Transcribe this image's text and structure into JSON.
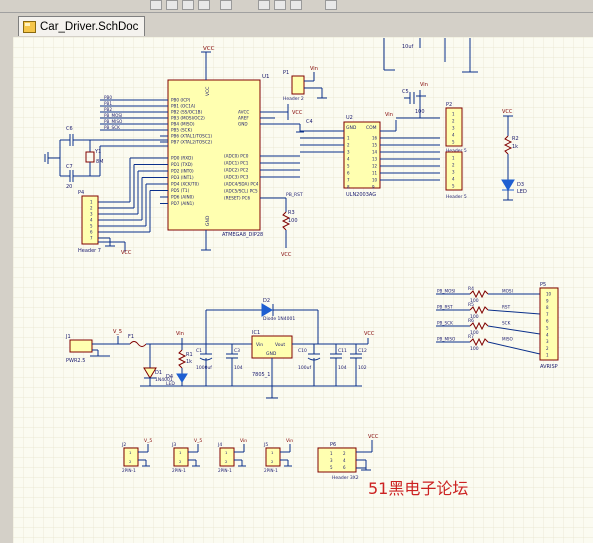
{
  "app": {
    "tab_label": "Car_Driver.SchDoc"
  },
  "toolbar": {
    "icons": [
      "new-icon",
      "open-icon",
      "save-icon",
      "print-icon",
      "zoom-icon",
      "cut-icon",
      "copy-icon",
      "paste-icon",
      "delete-icon"
    ]
  },
  "schematic": {
    "power": {
      "vcc": "VCC",
      "vin": "Vin",
      "v5": "V_5"
    },
    "u1": {
      "ref": "U1",
      "name": "ATMEGA8_DIP28",
      "pb_pins": [
        "PB0 (ICP)",
        "PB1 (OC1A)",
        "PB2 (SS/OC1B)",
        "PB3 (MOSI/OC2)",
        "PB4 (MISO)",
        "PB5 (SCK)",
        "PB6 (XTAL1/TOSC1)",
        "PB7 (XTAL2/TOSC2)"
      ],
      "pd_pins": [
        "PD0 (RXD)",
        "PD1 (TXD)",
        "PD2 (INT0)",
        "PD3 (INT1)",
        "PD4 (XCK/T0)",
        "PD5 (T1)",
        "PD6 (AIN0)",
        "PD7 (AIN1)"
      ],
      "right_top": [
        "AVCC",
        "AREF",
        "GND"
      ],
      "pc_pins": [
        "(ADC0) PC0",
        "(ADC1) PC1",
        "(ADC2) PC2",
        "(ADC3) PC3",
        "(ADC4/SDA) PC4",
        "(ADC5/SCL) PC5",
        "(RESET) PC6"
      ],
      "vcc_label": "VCC",
      "gnd_label": "GND",
      "pb_nets": [
        "PB0",
        "PB1",
        "PB2",
        "PB_MOSI",
        "PB_MISO",
        "PB_SCK"
      ],
      "pd_nets": [
        "PD0",
        "PD1",
        "PD2",
        "PD3"
      ],
      "rst_net": "PB_RST"
    },
    "u2": {
      "ref": "U2",
      "name": "ULN2003AG",
      "left_top": "GND",
      "right_top": "COM"
    },
    "crystal": {
      "ref": "Y1",
      "value": "8M",
      "c6": "C6",
      "c7": "C7",
      "cval": "20"
    },
    "p1": {
      "ref": "P1",
      "name": "Header 2"
    },
    "p2": {
      "ref": "P2",
      "name": "Header 5"
    },
    "p3": {
      "ref": "P3",
      "name": "Header 5"
    },
    "p4": {
      "ref": "P4",
      "name": "Header 7"
    },
    "p5": {
      "ref": "P5",
      "name": "AVRISP"
    },
    "p6": {
      "ref": "P6",
      "name": "Header 3X2"
    },
    "r2": {
      "ref": "R2",
      "value": "1k"
    },
    "r3": {
      "ref": "R3",
      "value": "100"
    },
    "d3": {
      "ref": "D3",
      "name": "LED"
    },
    "c4": {
      "ref": "C4",
      "value": "10uf"
    },
    "c5": {
      "ref": "C5",
      "value": "100"
    },
    "isp": {
      "nets": [
        "PB_MOSI",
        "PB_RST",
        "PB_SCK",
        "PB_MISO"
      ],
      "resistors": [
        "R4",
        "R5",
        "R6",
        "R7"
      ],
      "rvalue": "100",
      "sig": [
        "MOSI",
        "RST",
        "SCK",
        "MISO"
      ]
    },
    "power_supply": {
      "j1": "J1",
      "j1_name": "PWR2.5",
      "f1": "F1",
      "d2": "D2",
      "d2_name": "Diode 1N4001",
      "ic1": "IC1",
      "ic1_name": "7805_1",
      "vin_pin": "Vin",
      "vout_pin": "Vout",
      "gnd_pin": "GND",
      "d1": "D1",
      "d1_name": "1N4001",
      "d4": "D4",
      "d4_name": "LED",
      "r1": "R1",
      "r1_val": "1k",
      "caps": [
        {
          "ref": "C1",
          "val": "1000uf"
        },
        {
          "ref": "C3",
          "val": "104"
        },
        {
          "ref": "C10",
          "val": "100uf"
        },
        {
          "ref": "C11",
          "val": "104"
        },
        {
          "ref": "C12",
          "val": "102"
        }
      ]
    },
    "jumpers": [
      {
        "ref": "J2",
        "name": "2PIN-1",
        "net": "V_5"
      },
      {
        "ref": "J3",
        "name": "2PIN-1",
        "net": "V_5"
      },
      {
        "ref": "J4",
        "name": "2PIN-1",
        "net": "Vin"
      },
      {
        "ref": "J5",
        "name": "2PIN-1",
        "net": "Vin"
      }
    ],
    "top_partial": {
      "cap_val": "10uf"
    }
  },
  "watermark": "51黑电子论坛",
  "colors": {
    "sheet": "#fbfbf1",
    "grid": "#e6e3cc",
    "wire": "#0a2f8a",
    "comp": "#800000",
    "body": "#ffffb0",
    "text": "#1a1a6e",
    "red": "#c00000",
    "watermark": "#cc2222"
  }
}
